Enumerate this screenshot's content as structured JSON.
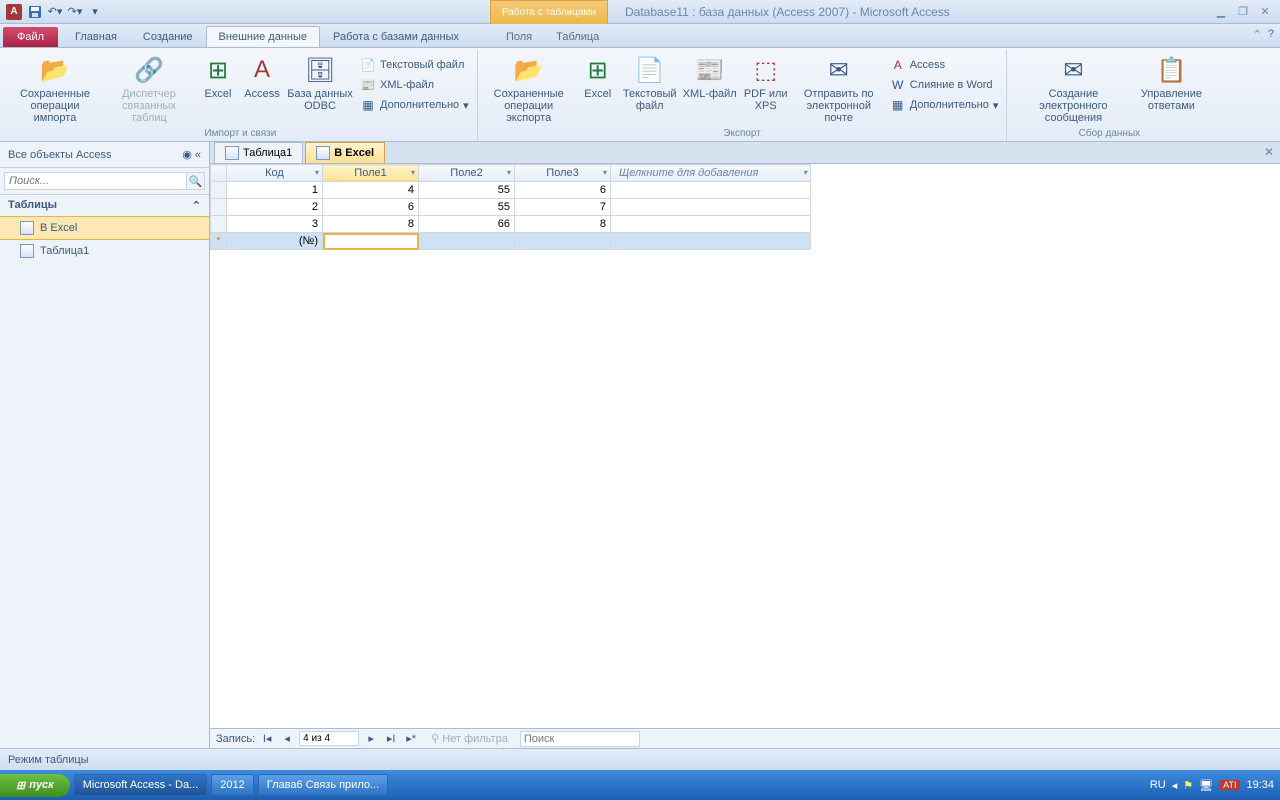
{
  "title": "Database11 : база данных (Access 2007)  -  Microsoft Access",
  "context_tools": "Работа с таблицами",
  "file_tab": "Файл",
  "ribbon_tabs": [
    "Главная",
    "Создание",
    "Внешние данные",
    "Работа с базами данных"
  ],
  "ribbon_active": 2,
  "context_tabs": [
    "Поля",
    "Таблица"
  ],
  "groups": {
    "import": {
      "saved_imports": "Сохраненные операции импорта",
      "linked_mgr": "Диспетчер связанных таблиц",
      "excel": "Excel",
      "access": "Access",
      "odbc": "База данных ODBC",
      "text": "Текстовый файл",
      "xml": "XML-файл",
      "more": "Дополнительно",
      "label": "Импорт и связи"
    },
    "export": {
      "saved_exports": "Сохраненные операции экспорта",
      "excel": "Excel",
      "text": "Текстовый файл",
      "xml": "XML-файл",
      "pdf": "PDF или XPS",
      "email": "Отправить по электронной почте",
      "access": "Access",
      "word": "Слияние в Word",
      "more": "Дополнительно",
      "label": "Экспорт"
    },
    "collect": {
      "create": "Создание электронного сообщения",
      "manage": "Управление ответами",
      "label": "Сбор данных"
    }
  },
  "nav": {
    "header": "Все объекты Access",
    "search_placeholder": "Поиск...",
    "group": "Таблицы",
    "items": [
      "В Excel",
      "Таблица1"
    ],
    "selected": 0
  },
  "doc_tabs": [
    {
      "label": "Таблица1",
      "active": false
    },
    {
      "label": "В Excel",
      "active": true
    }
  ],
  "columns": [
    "Код",
    "Поле1",
    "Поле2",
    "Поле3"
  ],
  "active_col": 1,
  "add_column": "Щелкните для добавления",
  "rows": [
    [
      1,
      4,
      55,
      6
    ],
    [
      2,
      6,
      55,
      7
    ],
    [
      3,
      8,
      66,
      8
    ]
  ],
  "new_row_label": "(№)",
  "record_nav": {
    "label": "Запись:",
    "pos": "4 из 4",
    "no_filter": "Нет фильтра",
    "search": "Поиск"
  },
  "status": "Режим таблицы",
  "taskbar": {
    "start": "пуск",
    "items": [
      {
        "label": "Microsoft Access - Da...",
        "active": true
      },
      {
        "label": "2012",
        "active": false
      },
      {
        "label": "Глава6 Связь прило...",
        "active": false
      }
    ],
    "lang": "RU",
    "tray_badge": "ATI",
    "time": "19:34"
  }
}
